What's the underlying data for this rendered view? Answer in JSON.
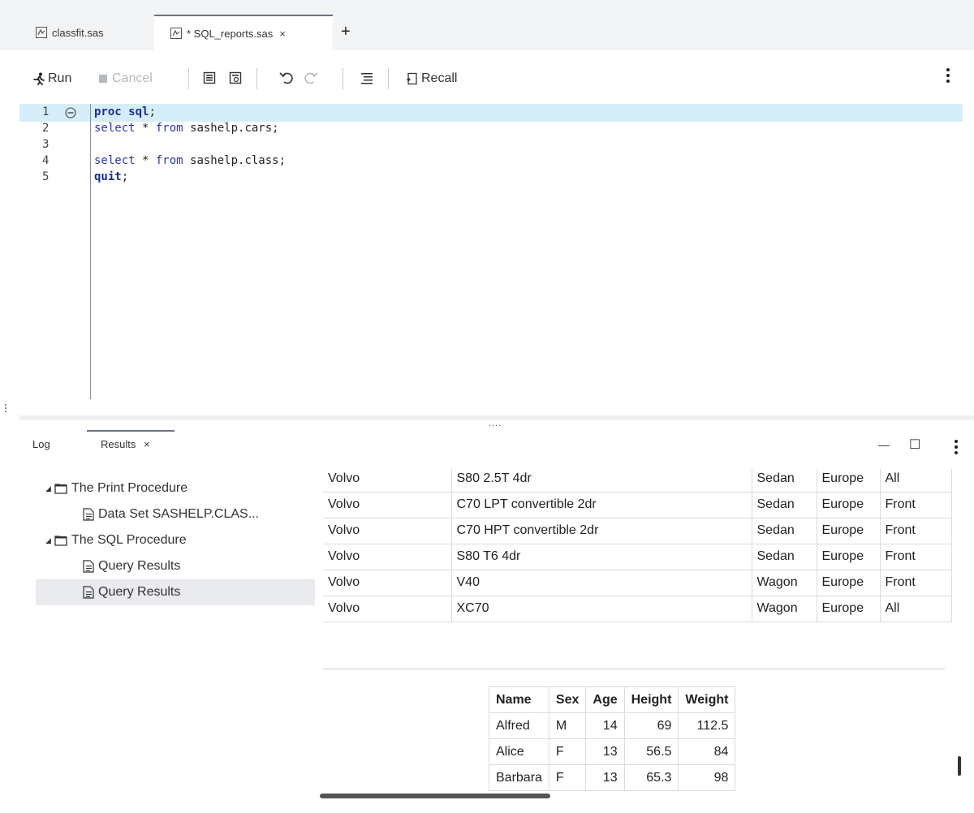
{
  "tabs": [
    {
      "label": "classfit.sas",
      "active": false
    },
    {
      "label": "* SQL_reports.sas",
      "active": true
    }
  ],
  "tab_close_glyph": "×",
  "new_tab_glyph": "+",
  "toolbar": {
    "run_label": "Run",
    "cancel_label": "Cancel",
    "recall_label": "Recall"
  },
  "editor": {
    "lines": [
      {
        "num": "1",
        "parts": [
          [
            "kw",
            "proc sql"
          ],
          [
            "plain",
            ";"
          ]
        ]
      },
      {
        "num": "2",
        "parts": [
          [
            "kw2",
            "select"
          ],
          [
            "plain",
            " * "
          ],
          [
            "kw2",
            "from"
          ],
          [
            "plain",
            " sashelp.cars;"
          ]
        ]
      },
      {
        "num": "3",
        "parts": []
      },
      {
        "num": "4",
        "parts": [
          [
            "kw2",
            "select"
          ],
          [
            "plain",
            " * "
          ],
          [
            "kw2",
            "from"
          ],
          [
            "plain",
            " sashelp.class;"
          ]
        ]
      },
      {
        "num": "5",
        "parts": [
          [
            "kw",
            "quit"
          ],
          [
            "plain",
            ";"
          ]
        ]
      }
    ]
  },
  "splitter_grip": "....",
  "bottom_tabs": {
    "log_label": "Log",
    "results_label": "Results",
    "close_glyph": "×",
    "minimize_glyph": "—",
    "maximize_glyph": "☐"
  },
  "tree": {
    "print_proc": "The Print Procedure",
    "dataset": "Data Set SASHELP.CLAS...",
    "sql_proc": "The SQL Procedure",
    "query1": "Query Results",
    "query2": "Query Results"
  },
  "cars_rows": [
    [
      "Volvo",
      "S80 2.5T 4dr",
      "Sedan",
      "Europe",
      "All"
    ],
    [
      "Volvo",
      "C70 LPT convertible 2dr",
      "Sedan",
      "Europe",
      "Front"
    ],
    [
      "Volvo",
      "C70 HPT convertible 2dr",
      "Sedan",
      "Europe",
      "Front"
    ],
    [
      "Volvo",
      "S80 T6 4dr",
      "Sedan",
      "Europe",
      "Front"
    ],
    [
      "Volvo",
      "V40",
      "Wagon",
      "Europe",
      "Front"
    ],
    [
      "Volvo",
      "XC70",
      "Wagon",
      "Europe",
      "All"
    ]
  ],
  "class_table": {
    "headers": [
      "Name",
      "Sex",
      "Age",
      "Height",
      "Weight"
    ],
    "rows": [
      [
        "Alfred",
        "M",
        "14",
        "69",
        "112.5"
      ],
      [
        "Alice",
        "F",
        "13",
        "56.5",
        "84"
      ],
      [
        "Barbara",
        "F",
        "13",
        "65.3",
        "98"
      ]
    ]
  },
  "colors": {
    "current_line": "#d6eefa",
    "keyword": "#1b2aa6",
    "selected_tree": "#e9ebee"
  }
}
